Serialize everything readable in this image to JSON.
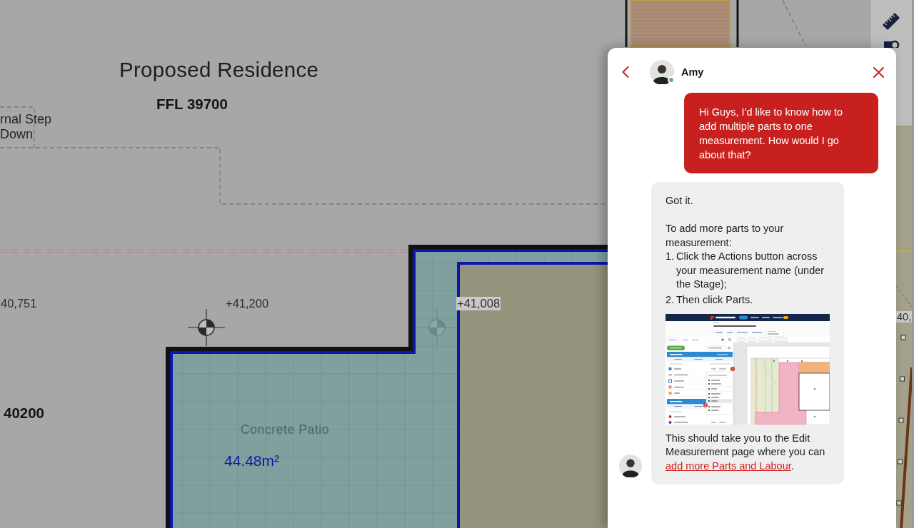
{
  "plan": {
    "title": "Proposed Residence",
    "floor_level": "FFL 39700",
    "step_note": "rnal Step Down",
    "spot_levels": [
      {
        "text": "40,751",
        "highlighted": false
      },
      {
        "text": "+41,200",
        "highlighted": false
      },
      {
        "text": "+41,008",
        "highlighted": true
      },
      {
        "text": "40,",
        "highlighted": true
      }
    ],
    "level_mark": "40200",
    "area": {
      "name": "Concrete Patio",
      "size": "44.48m²"
    }
  },
  "chat": {
    "agent": {
      "name": "Amy",
      "online": true
    },
    "messages": [
      {
        "kind": "sent",
        "text": "Hi Guys, I'd like to know how to add multiple parts to one measurement. How would I go about that?"
      },
      {
        "kind": "received",
        "blocks": [
          {
            "kind": "text",
            "text": "Got it."
          },
          {
            "kind": "text",
            "text": "To add more parts to your measurement:"
          },
          {
            "kind": "list",
            "items": [
              {
                "number": "1.",
                "text": "Click the Actions button across your measurement name (under the Stage);"
              },
              {
                "number": "2.",
                "text": "Then click Parts."
              }
            ]
          },
          {
            "kind": "image"
          },
          {
            "kind": "text",
            "text": "This should take you to the Edit Measurement page where you can ",
            "link": "add more Parts and Labour",
            "after": "."
          }
        ]
      }
    ]
  }
}
